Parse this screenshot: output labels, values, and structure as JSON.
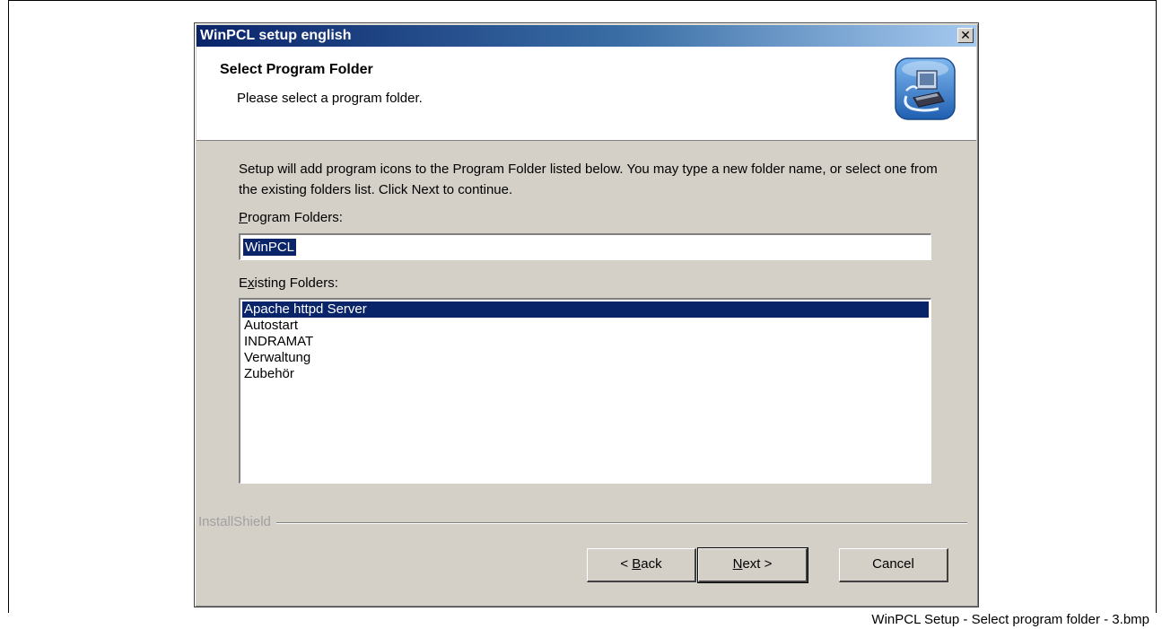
{
  "window": {
    "title": "WinPCL setup english",
    "close_glyph": "✕"
  },
  "header": {
    "title": "Select Program Folder",
    "subtitle": "Please select a program folder.",
    "icon": "computer-setup-icon"
  },
  "body": {
    "description": "Setup will add program icons to the Program Folder listed below.  You may type a new folder name, or select one from the existing folders list.  Click Next to continue.",
    "program_folders_label_first": "P",
    "program_folders_label_rest": "rogram Folders:",
    "program_folder_value": "WinPCL",
    "existing_folders_label_first": "E",
    "existing_folders_label_u": "x",
    "existing_folders_label_rest": "isting Folders:",
    "existing_folders": [
      "Apache httpd Server",
      "Autostart",
      "INDRAMAT",
      "Verwaltung",
      "Zubehör"
    ],
    "selected_folder_index": 0
  },
  "footer": {
    "brand": "InstallShield",
    "back_prefix": "< ",
    "back_u": "B",
    "back_rest": "ack",
    "next_u": "N",
    "next_rest": "ext >",
    "cancel": "Cancel"
  },
  "caption": "WinPCL Setup - Select program folder - 3.bmp",
  "colors": {
    "title_gradient_start": "#0a246a",
    "title_gradient_end": "#a6caf0",
    "selection": "#0a246a",
    "dialog_face": "#d4d0c8"
  }
}
